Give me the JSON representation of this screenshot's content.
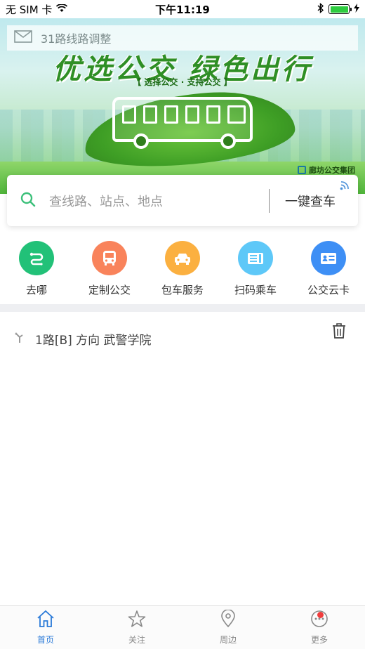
{
  "status_bar": {
    "carrier": "无 SIM 卡",
    "time": "下午11:19",
    "battery_level": 1.0
  },
  "banner": {
    "slogan": "优选公交 绿色出行",
    "subtitle": "【 选择公交 · 支持公交 】",
    "company": "廊坊公交集团"
  },
  "notice": {
    "icon": "envelope-icon",
    "text": "31路线路调整"
  },
  "search": {
    "placeholder": "查线路、站点、地点",
    "quick_check_label": "一键查车"
  },
  "quick_actions": [
    {
      "label": "去哪",
      "icon": "route-icon",
      "color": "#22c178"
    },
    {
      "label": "定制公交",
      "icon": "bus-icon",
      "color": "#f9835b"
    },
    {
      "label": "包车服务",
      "icon": "car-icon",
      "color": "#fbb040"
    },
    {
      "label": "扫码乘车",
      "icon": "scan-ticket-icon",
      "color": "#5ec8f8"
    },
    {
      "label": "公交云卡",
      "icon": "card-icon",
      "color": "#3e8ff5"
    }
  ],
  "history": [
    {
      "text": "1路[B] 方向 武警学院"
    }
  ],
  "tabs": [
    {
      "label": "首页",
      "icon": "home-icon",
      "active": true
    },
    {
      "label": "关注",
      "icon": "star-icon",
      "active": false
    },
    {
      "label": "周边",
      "icon": "location-pin-icon",
      "active": false
    },
    {
      "label": "更多",
      "icon": "more-icon",
      "active": false,
      "badge": true
    }
  ],
  "colors": {
    "accent": "#2a7ad8",
    "badge": "#f03c3c",
    "search_icon": "#3cc07a"
  }
}
